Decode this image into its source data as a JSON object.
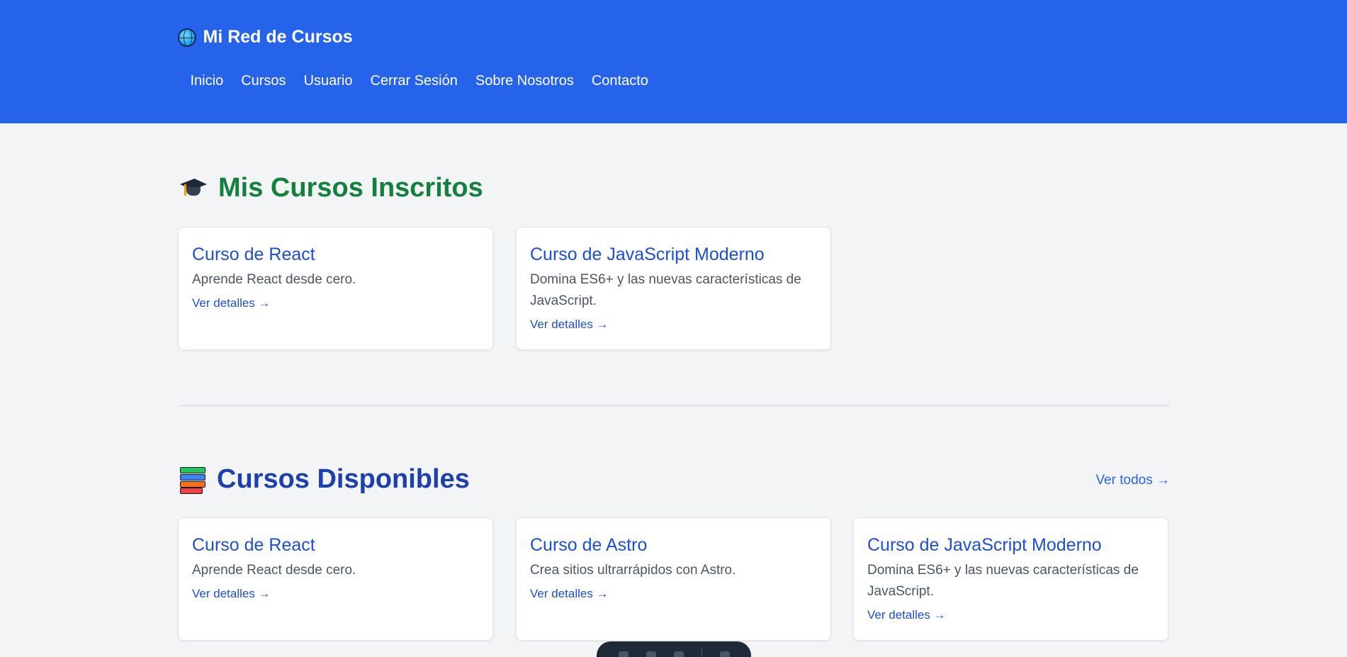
{
  "header": {
    "brand": "Mi Red de Cursos",
    "brand_icon": "globe-icon",
    "nav": [
      "Inicio",
      "Cursos",
      "Usuario",
      "Cerrar Sesión",
      "Sobre Nosotros",
      "Contacto"
    ]
  },
  "enrolled": {
    "title": "Mis Cursos Inscritos",
    "icon": "graduation-cap-icon",
    "courses": [
      {
        "title": "Curso de React",
        "description": "Aprende React desde cero.",
        "link": "Ver detalles →"
      },
      {
        "title": "Curso de JavaScript Moderno",
        "description": "Domina ES6+ y las nuevas características de JavaScript.",
        "link": "Ver detalles →"
      }
    ]
  },
  "available": {
    "title": "Cursos Disponibles",
    "icon": "books-icon",
    "see_all": "Ver todos →",
    "courses": [
      {
        "title": "Curso de React",
        "description": "Aprende React desde cero.",
        "link": "Ver detalles →"
      },
      {
        "title": "Curso de Astro",
        "description": "Crea sitios ultrarrápidos con Astro.",
        "link": "Ver detalles →"
      },
      {
        "title": "Curso de JavaScript Moderno",
        "description": "Domina ES6+ y las nuevas características de JavaScript.",
        "link": "Ver detalles →"
      }
    ]
  },
  "colors": {
    "header_bg": "#2563eb",
    "page_bg": "#f3f4f6",
    "enrolled_title": "#15803d",
    "available_title": "#1e40af",
    "link": "#1d4ed8"
  }
}
